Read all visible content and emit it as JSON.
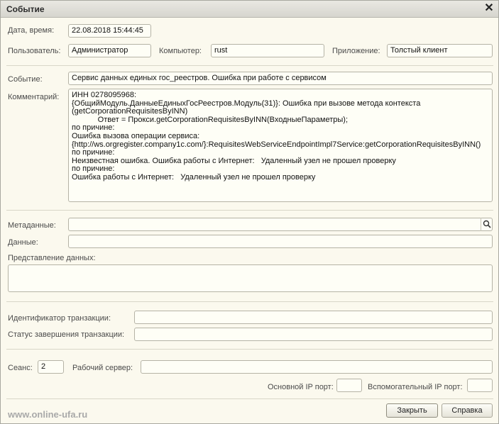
{
  "window": {
    "title": "Событие",
    "close_icon": "close-icon"
  },
  "fields": {
    "datetime_label": "Дата, время:",
    "datetime_value": "22.08.2018 15:44:45",
    "user_label": "Пользователь:",
    "user_value": "Администратор",
    "computer_label": "Компьютер:",
    "computer_value": "rust",
    "app_label": "Приложение:",
    "app_value": "Толстый клиент",
    "event_label": "Событие:",
    "event_value": "Сервис данных единых гос_реестров. Ошибка при работе с сервисом",
    "comment_label": "Комментарий:",
    "comment_lines": [
      "ИНН 0278095968:",
      "{ОбщийМодуль.ДанныеЕдиныхГосРеестров.Модуль(31)}: Ошибка при вызове метода контекста",
      "(getCorporationRequisitesByINN)",
      "            Ответ = Прокси.getCorporationRequisitesByINN(ВходныеПараметры);",
      "по причине:",
      "Ошибка вызова операции сервиса:",
      "{http://ws.orgregister.company1c.com/}:RequisitesWebServiceEndpointImpl7Service:getCorporationRequisitesByINN()",
      "по причине:",
      "Неизвестная ошибка. Ошибка работы с Интернет:   Удаленный узел не прошел проверку",
      "по причине:",
      "Ошибка работы с Интернет:   Удаленный узел не прошел проверку"
    ],
    "metadata_label": "Метаданные:",
    "metadata_value": "",
    "data_label": "Данные:",
    "data_value": "",
    "data_repr_label": "Представление данных:",
    "data_repr_value": "",
    "transaction_id_label": "Идентификатор транзакции:",
    "transaction_id_value": "",
    "transaction_status_label": "Статус завершения транзакции:",
    "transaction_status_value": "",
    "session_label": "Сеанс:",
    "session_value": "2",
    "server_label": "Рабочий сервер:",
    "server_value": "",
    "main_port_label": "Основной IP порт:",
    "main_port_value": "",
    "aux_port_label": "Вспомогательный IP порт:",
    "aux_port_value": ""
  },
  "buttons": {
    "close_label": "Закрыть",
    "help_label": "Справка"
  },
  "watermark": "www.online-ufa.ru"
}
